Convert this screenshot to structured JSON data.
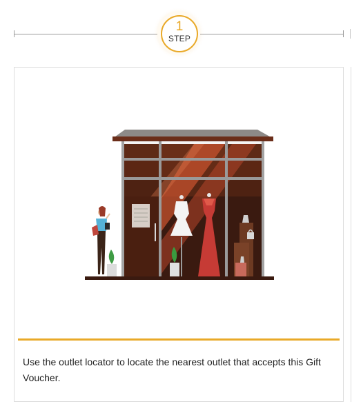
{
  "step": {
    "number": "1",
    "label": "STEP"
  },
  "card": {
    "illustration": "storefront-illustration",
    "description": "Use the outlet locator to locate the nearest outlet that accepts this Gift Voucher."
  },
  "colors": {
    "accent": "#e9a928",
    "line": "#9a9a9a",
    "border": "#dddddd",
    "text": "#222222"
  }
}
